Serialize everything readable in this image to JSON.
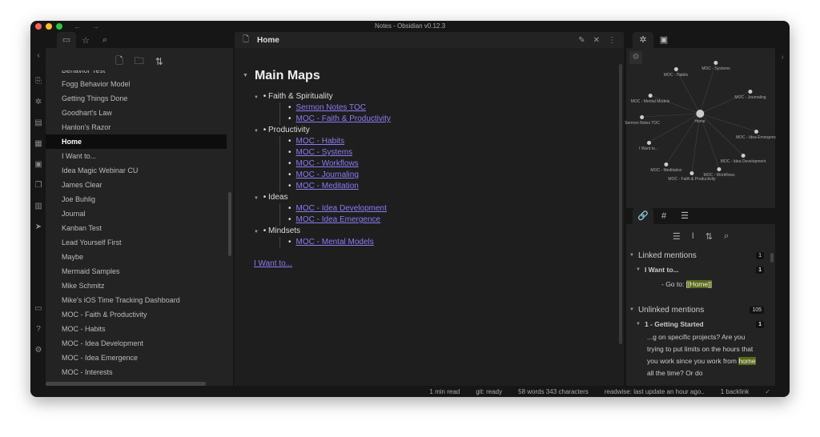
{
  "window": {
    "title": "Notes - Obsidian v0.12.3"
  },
  "file_pane": {
    "items": [
      "Behavior Test",
      "Fogg Behavior Model",
      "Getting Things Done",
      "Goodhart's Law",
      "Hanlon's Razor",
      "Home",
      "I Want to...",
      "Idea Magic Webinar CU",
      "James Clear",
      "Joe Buhlig",
      "Journal",
      "Kanban Test",
      "Lead Yourself First",
      "Maybe",
      "Mermaid Samples",
      "Mike Schmitz",
      "Mike's iOS Time Tracking Dashboard",
      "MOC - Faith & Productivity",
      "MOC - Habits",
      "MOC - Idea Development",
      "MOC - Idea Emergence",
      "MOC - Interests"
    ],
    "selected": "Home"
  },
  "editor": {
    "tab_title": "Home",
    "heading": "Main Maps",
    "sections": [
      {
        "title": "Faith & Spirituality",
        "links": [
          "Sermon Notes TOC",
          "MOC - Faith & Productivity"
        ]
      },
      {
        "title": "Productivity",
        "links": [
          "MOC - Habits",
          "MOC - Systems",
          "MOC - Workflows",
          "MOC - Journaling",
          "MOC - Meditation"
        ]
      },
      {
        "title": "Ideas",
        "links": [
          "MOC - Idea Development",
          "MOC - Idea Emergence"
        ]
      },
      {
        "title": "Mindsets",
        "links": [
          "MOC - Mental Models"
        ]
      }
    ],
    "footer_link": "I Want to..."
  },
  "graph": {
    "center": "Home",
    "nodes": [
      "MOC - Habits",
      "MOC - Systems",
      "MOC - Mental Models",
      "MOC - Journaling",
      "Sermon Notes TOC",
      "MOC - Idea Emergenc",
      "I Want to...",
      "MOC - Idea Development",
      "MOC - Meditation",
      "MOC - Workflows",
      "MOC - Faith & Productivity"
    ]
  },
  "backlinks": {
    "linked_label": "Linked mentions",
    "linked_count": "1",
    "linked_file": "I Want to...",
    "linked_file_count": "1",
    "linked_prefix": "- Go to: ",
    "linked_match": "[[Home]]",
    "unlinked_label": "Unlinked mentions",
    "unlinked_count": "105",
    "unlinked_file": "1 - Getting Started",
    "unlinked_file_count": "1",
    "snippet_before": "...g on specific projects? Are you trying to put limits on the hours that you work since you work from ",
    "snippet_match": "home",
    "snippet_after": " all the time? Or do"
  },
  "status": {
    "read": "1 min read",
    "git": "git: ready",
    "count": "58 words 343 characters",
    "readwise": "readwise: last update an hour ago..",
    "backlinks": "1 backlink"
  }
}
